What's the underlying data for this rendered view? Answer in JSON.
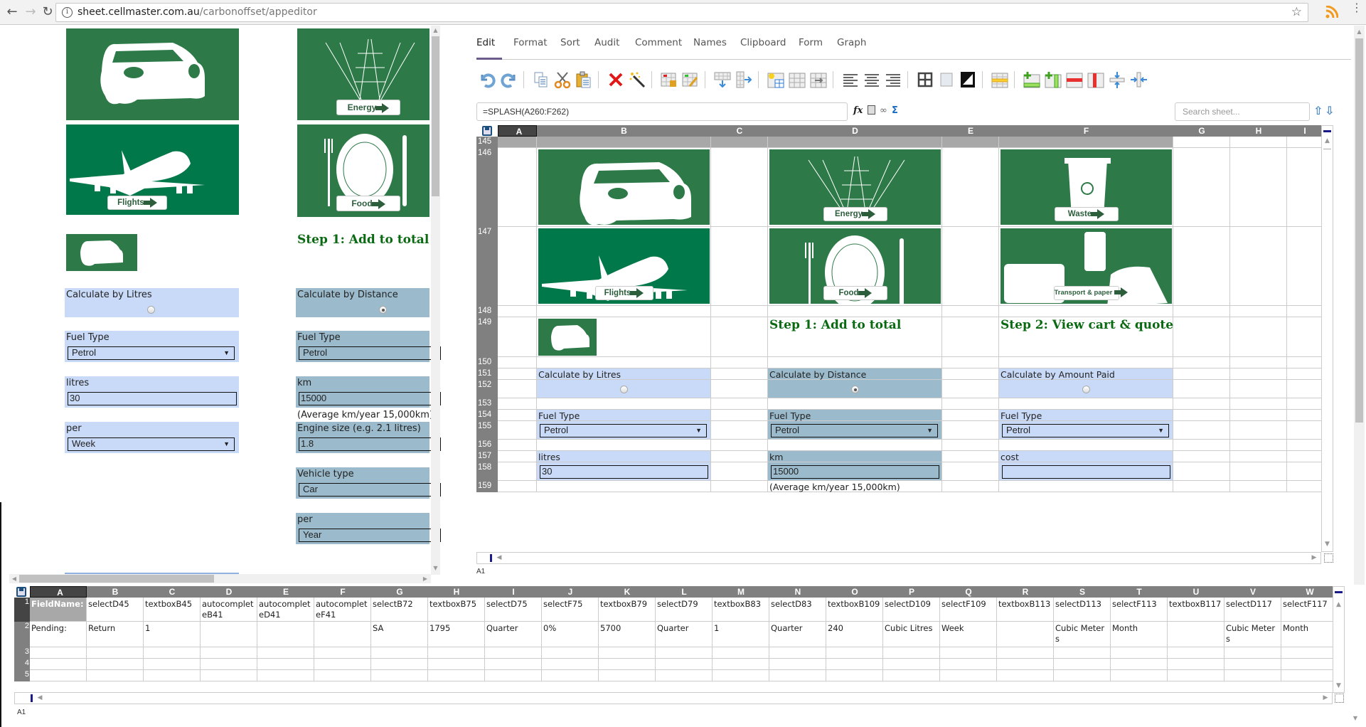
{
  "browser": {
    "url_host": "sheet.cellmaster.com.au",
    "url_path": "/carbonoffset/appeditor"
  },
  "left_preview": {
    "tiles": [
      {
        "name": "car",
        "label": ""
      },
      {
        "name": "energy",
        "label": "Energy"
      },
      {
        "name": "flights",
        "label": "Flights"
      },
      {
        "name": "food",
        "label": "Food"
      }
    ],
    "step1_heading": "Step 1: Add to total",
    "litres_card": {
      "title": "Calculate by Litres",
      "selected": false,
      "fuel_label": "Fuel Type",
      "fuel_value": "Petrol",
      "qty_label": "litres",
      "qty_value": "30",
      "per_label": "per",
      "per_value": "Week"
    },
    "distance_card": {
      "title": "Calculate by Distance",
      "selected": true,
      "fuel_label": "Fuel Type",
      "fuel_value": "Petrol",
      "qty_label": "km",
      "qty_value": "15000",
      "note": "(Average km/year 15,000km)",
      "engine_label": "Engine size (e.g. 2.1 litres)",
      "engine_value": "1.8",
      "vehicle_label": "Vehicle type",
      "vehicle_value": "Car",
      "per_label": "per",
      "per_value": "Year"
    }
  },
  "editor": {
    "tabs": [
      "Edit",
      "Format",
      "Sort",
      "Audit",
      "Comment",
      "Names",
      "Clipboard",
      "Form",
      "Graph"
    ],
    "active_tab": "Edit",
    "toolbar": [
      "undo-icon",
      "redo-icon",
      "copy-icon",
      "cut-icon",
      "paste-icon",
      "delete-icon",
      "magic-wand-icon",
      "lock-cells-icon",
      "edit-cells-icon",
      "insert-rows-icon",
      "insert-cols-icon",
      "new-table-icon",
      "merge-cells-icon",
      "unmerge-cells-icon",
      "align-left-icon",
      "align-center-icon",
      "align-right-icon",
      "borders-icon",
      "fill-color-icon",
      "text-color-icon",
      "highlight-row-icon",
      "add-row-icon",
      "add-column-icon",
      "delete-row-icon",
      "delete-column-icon",
      "shrink-rows-icon",
      "shrink-cols-icon"
    ],
    "formula": "=SPLASH(A260:F262)",
    "search_placeholder": "Search sheet...",
    "columns": [
      "A",
      "B",
      "C",
      "D",
      "E",
      "F",
      "G",
      "H",
      "I"
    ],
    "rows": [
      "145",
      "146",
      "147",
      "148",
      "149",
      "150",
      "151",
      "152",
      "153",
      "154",
      "155",
      "156",
      "157",
      "158",
      "159"
    ],
    "tiles_row146": [
      {
        "name": "car",
        "label": ""
      },
      {
        "name": "energy",
        "label": "Energy"
      },
      {
        "name": "waste",
        "label": "Waste"
      }
    ],
    "tiles_row147": [
      {
        "name": "flights",
        "label": "Flights"
      },
      {
        "name": "food",
        "label": "Food"
      },
      {
        "name": "transport",
        "label": "Transport & paper"
      }
    ],
    "step1": "Step 1: Add to total",
    "step2": "Step 2: View cart & quote",
    "cards": [
      {
        "title": "Calculate by Litres",
        "selected": false,
        "fuel_label": "Fuel Type",
        "fuel_value": "Petrol",
        "qty_label": "litres",
        "qty_value": "30"
      },
      {
        "title": "Calculate by Distance",
        "selected": true,
        "fuel_label": "Fuel Type",
        "fuel_value": "Petrol",
        "qty_label": "km",
        "qty_value": "15000",
        "note": "(Average km/year 15,000km)"
      },
      {
        "title": "Calculate by Amount Paid",
        "selected": false,
        "fuel_label": "Fuel Type",
        "fuel_value": "Petrol",
        "qty_label": "cost",
        "qty_value": ""
      }
    ],
    "cell_ref": "A1"
  },
  "pending_grid": {
    "columns": [
      "A",
      "B",
      "C",
      "D",
      "E",
      "F",
      "G",
      "H",
      "I",
      "J",
      "K",
      "L",
      "M",
      "N",
      "O",
      "P",
      "Q",
      "R",
      "S",
      "T",
      "U",
      "V",
      "W"
    ],
    "row1": [
      "FieldName:",
      "selectD45",
      "textboxB45",
      "autocompleteB41",
      "autocompleteD41",
      "autocompleteF41",
      "selectB72",
      "textboxB75",
      "selectD75",
      "selectF75",
      "textboxB79",
      "selectD79",
      "textboxB83",
      "selectD83",
      "textboxB109",
      "selectD109",
      "selectF109",
      "textboxB113",
      "selectD113",
      "selectF113",
      "textboxB117",
      "selectD117",
      "selectF117"
    ],
    "row2": [
      "Pending:",
      "Return",
      "1",
      "",
      "",
      "",
      "SA",
      "1795",
      "Quarter",
      "0%",
      "5700",
      "Quarter",
      "1",
      "Quarter",
      "240",
      "Cubic Litres",
      "Week",
      "",
      "Cubic Meters",
      "Month",
      "",
      "Cubic Meters",
      "Month"
    ],
    "row_labels": [
      "1",
      "2",
      "3",
      "4",
      "5"
    ],
    "cell_ref": "A1"
  },
  "colors": {
    "tile_green": "#2d7a48",
    "step_green": "#0a6a12",
    "card_blue": "#c9daf8",
    "card_selected": "#9bbbcc",
    "header_grey": "#808080"
  }
}
